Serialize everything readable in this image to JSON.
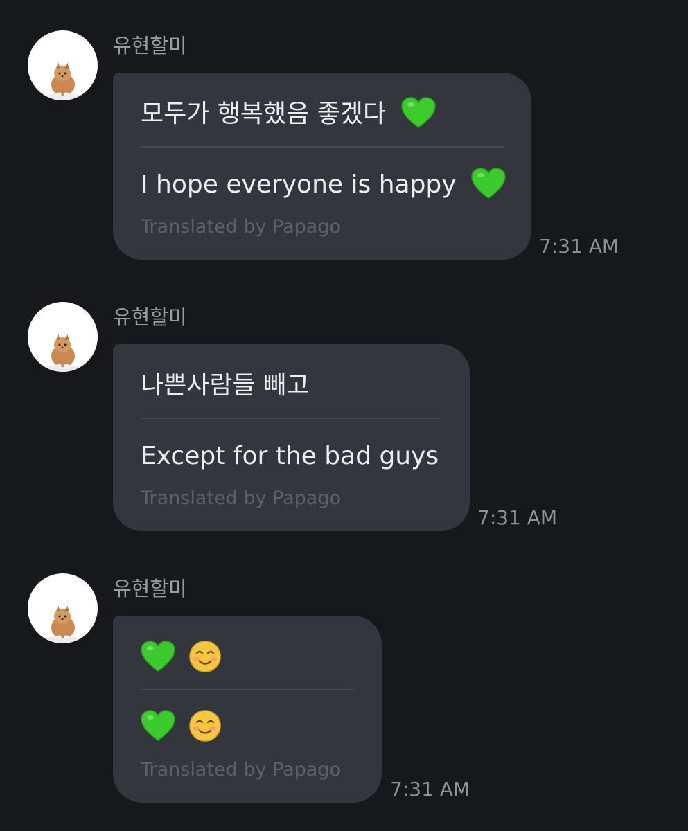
{
  "messages": [
    {
      "sender": "유현할미",
      "original": "모두가 행복했음 좋겠다",
      "translation": "I hope everyone is happy",
      "credit": "Translated by Papago",
      "time": "7:31 AM",
      "emojis_original": [
        "green-heart"
      ],
      "emojis_translation": [
        "green-heart"
      ]
    },
    {
      "sender": "유현할미",
      "original": "나쁜사람들 빼고",
      "translation": "Except for the bad guys",
      "credit": "Translated by Papago",
      "time": "7:31 AM",
      "emojis_original": [],
      "emojis_translation": []
    },
    {
      "sender": "유현할미",
      "original": "",
      "translation": "",
      "credit": "Translated by Papago",
      "time": "7:31 AM",
      "emojis_original": [
        "green-heart",
        "smiling-face"
      ],
      "emojis_translation": [
        "green-heart",
        "smiling-face"
      ]
    }
  ],
  "colors": {
    "background": "#17181c",
    "bubble": "#34363d",
    "text": "#eceef1",
    "sender": "#9a9ba0",
    "credit": "#5d6068",
    "divider": "#464850",
    "heart": "#3ccb2c",
    "smile": "#f6c640"
  }
}
